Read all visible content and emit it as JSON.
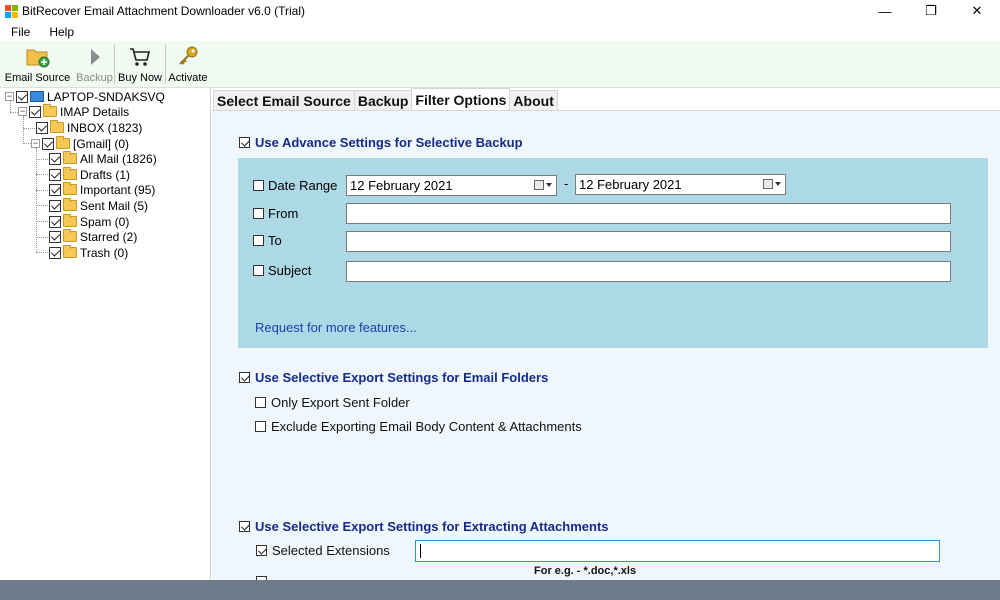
{
  "window": {
    "title": "BitRecover Email Attachment Downloader v6.0 (Trial)",
    "minimize": "—",
    "maximize": "❐",
    "close": "✕"
  },
  "menu": {
    "file": "File",
    "help": "Help"
  },
  "toolbar": {
    "email_source": "Email Source",
    "backup": "Backup",
    "buy_now": "Buy Now",
    "activate": "Activate"
  },
  "tree": {
    "root": "LAPTOP-SNDAKSVQ",
    "imap": "IMAP Details",
    "inbox": "INBOX (1823)",
    "gmail": "[Gmail] (0)",
    "items": [
      {
        "label": "All Mail (1826)"
      },
      {
        "label": "Drafts (1)"
      },
      {
        "label": "Important (95)"
      },
      {
        "label": "Sent Mail (5)"
      },
      {
        "label": "Spam (0)"
      },
      {
        "label": "Starred (2)"
      },
      {
        "label": "Trash (0)"
      }
    ]
  },
  "tabs": [
    "Select Email Source",
    "Backup",
    "Filter Options",
    "About"
  ],
  "active_tab": "Filter Options",
  "filter": {
    "advance_label": "Use Advance Settings for Selective Backup",
    "date_range_label": "Date Range",
    "date_from": "12  February  2021",
    "date_separator": "-",
    "date_to": "12  February  2021",
    "from_label": "From",
    "to_label": "To",
    "subject_label": "Subject",
    "request_link": "Request for more features..."
  },
  "folders": {
    "header": "Use Selective Export Settings for Email Folders",
    "only_sent": "Only Export Sent Folder",
    "exclude_body": "Exclude Exporting Email Body Content & Attachments"
  },
  "attachments": {
    "header": "Use Selective Export Settings for Extracting Attachments",
    "selected_ext": "Selected Extensions",
    "hint": "For e.g. - *.doc,*.xls"
  },
  "colors": {
    "panel_blue": "#add8e6",
    "header_blue": "#152a8c",
    "link_blue": "#1a3fb0",
    "toolbar_bg": "#f1f9f3",
    "status_bar": "#6f7b8a"
  }
}
